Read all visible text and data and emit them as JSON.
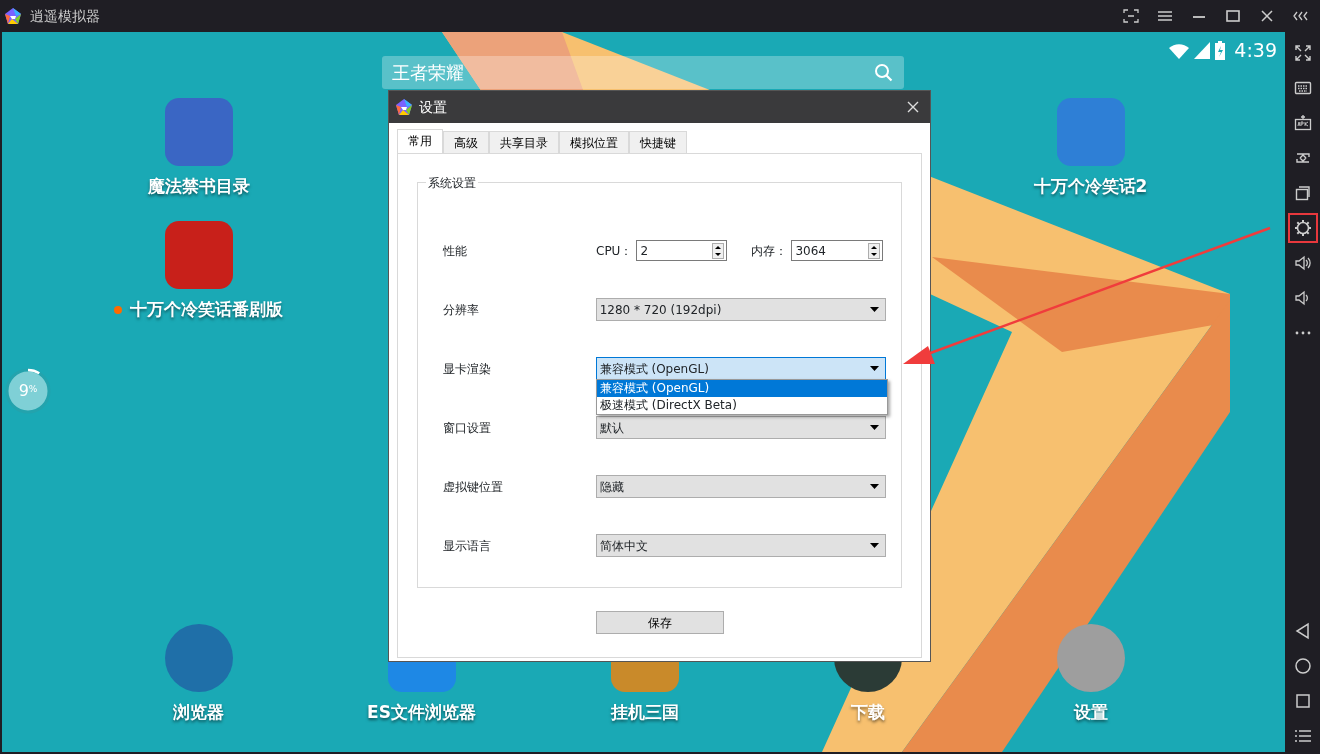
{
  "window": {
    "title": "逍遥模拟器"
  },
  "status_bar": {
    "time": "4:39"
  },
  "search": {
    "value": "王者荣耀"
  },
  "home_apps": [
    {
      "label": "魔法禁书目录",
      "new": false
    },
    {
      "label": "十万个冷笑话2",
      "new": false
    },
    {
      "label": "十万个冷笑话番剧版",
      "new": true
    }
  ],
  "dock": [
    {
      "label": "浏览器"
    },
    {
      "label": "ES文件浏览器"
    },
    {
      "label": "挂机三国"
    },
    {
      "label": "下载"
    },
    {
      "label": "设置"
    }
  ],
  "progress": {
    "level": 0.09,
    "reading": "9$^{%}$"
  },
  "toolbar": [
    {
      "kind": "fullscreen",
      "highlighted": false
    },
    {
      "kind": "keyboard",
      "highlighted": false
    },
    {
      "kind": "apk",
      "highlighted": false
    },
    {
      "kind": "sync",
      "highlighted": false
    },
    {
      "kind": "windows",
      "highlighted": false
    },
    {
      "kind": "settings",
      "highlighted": true
    },
    {
      "kind": "volume-up",
      "highlighted": false
    },
    {
      "kind": "volume-down",
      "highlighted": false
    },
    {
      "kind": "more",
      "highlighted": false
    }
  ],
  "nav_buttons": [
    {
      "kind": "back"
    },
    {
      "kind": "home"
    },
    {
      "kind": "recent"
    },
    {
      "kind": "menu"
    }
  ],
  "dialog": {
    "title": "设置",
    "tabs": [
      {
        "label": "常用",
        "selected": true
      },
      {
        "label": "高级",
        "selected": false
      },
      {
        "label": "共享目录",
        "selected": false
      },
      {
        "label": "模拟位置",
        "selected": false
      },
      {
        "label": "快捷键",
        "selected": false
      }
    ],
    "group": {
      "title": "系统设置",
      "rows": [
        {
          "kind": "spinners",
          "label": "性能",
          "fields": [
            {
              "label": "CPU：",
              "value": "2"
            },
            {
              "label": "内存：",
              "value": "3064"
            }
          ]
        },
        {
          "kind": "select",
          "label": "分辨率",
          "value": "1280 * 720 (192dpi)",
          "expanded": false
        },
        {
          "kind": "select",
          "label": "显卡渲染",
          "value": "兼容模式 (OpenGL)",
          "expanded": true,
          "options": [
            {
              "label": "兼容模式 (OpenGL)",
              "selected": true
            },
            {
              "label": "极速模式 (DirectX Beta)",
              "selected": false
            }
          ]
        },
        {
          "kind": "select",
          "label": "窗口设置",
          "value": "默认",
          "expanded": false
        },
        {
          "kind": "select",
          "label": "虚拟键位置",
          "value": "隐藏",
          "expanded": false
        },
        {
          "kind": "select",
          "label": "显示语言",
          "value": "简体中文",
          "expanded": false
        }
      ]
    },
    "save_button": "保存"
  }
}
